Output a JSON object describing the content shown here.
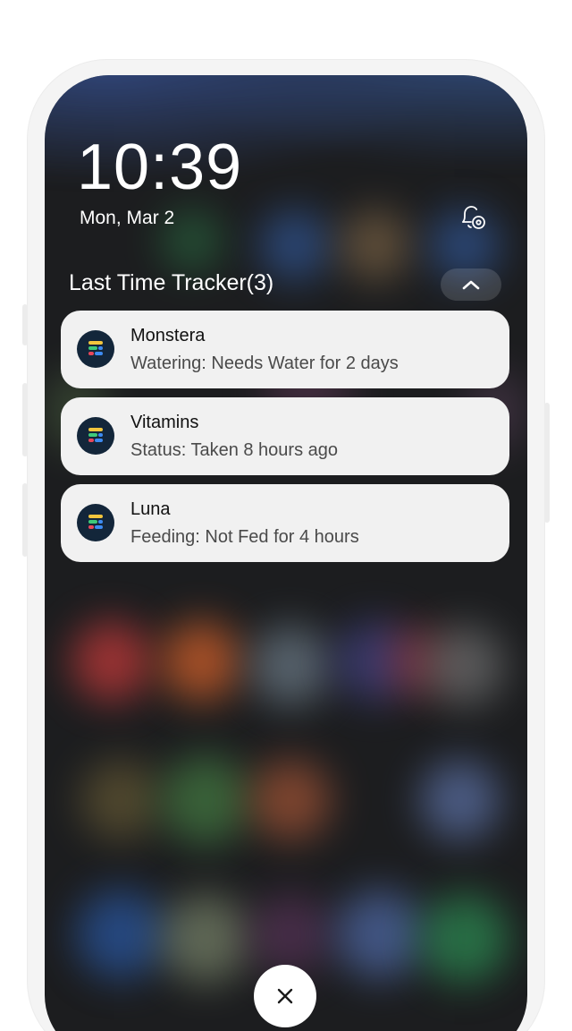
{
  "lockscreen": {
    "time": "10:39",
    "date": "Mon, Mar 2"
  },
  "notification_group": {
    "title": "Last Time Tracker(3)",
    "collapse_icon": "chevron-up-icon",
    "items": [
      {
        "title": "Monstera",
        "text": "Watering: Needs Water for 2 days",
        "icon": "last-time-tracker-app-icon"
      },
      {
        "title": "Vitamins",
        "text": "Status: Taken 8 hours ago",
        "icon": "last-time-tracker-app-icon"
      },
      {
        "title": "Luna",
        "text": "Feeding: Not Fed for 4 hours",
        "icon": "last-time-tracker-app-icon"
      }
    ]
  },
  "icons": {
    "notification_settings": "bell-settings-icon",
    "close": "close-icon"
  },
  "colors": {
    "screen_background": "#1c1d1f",
    "card_background": "#f1f1f1",
    "app_icon_background": "#13263a",
    "app_icon_bars": [
      "#f2c53d",
      "#3ec97a",
      "#e9475b",
      "#3d8bf2"
    ]
  }
}
